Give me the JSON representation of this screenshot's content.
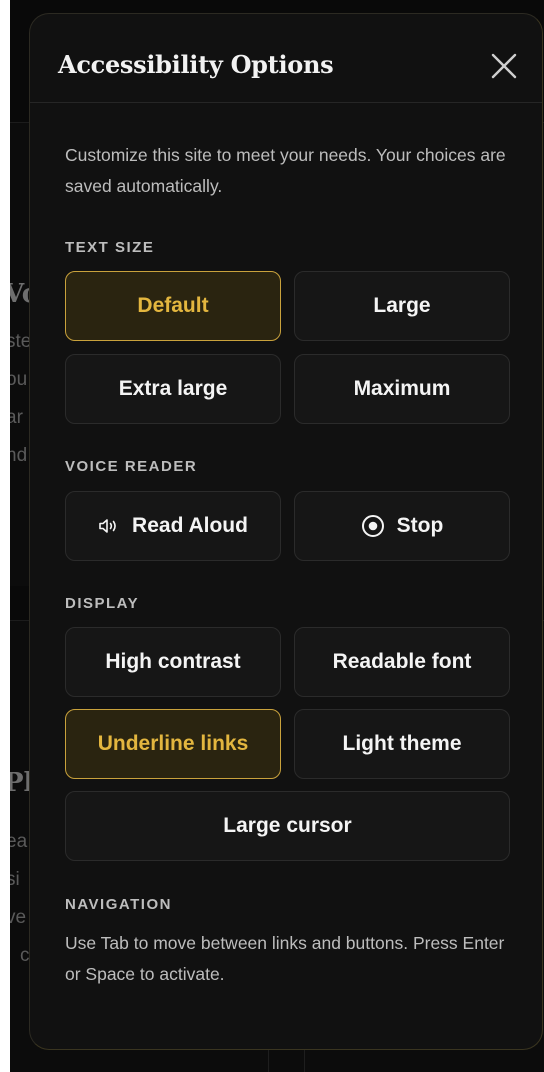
{
  "panel": {
    "title": "Accessibility Options",
    "close_label": "Close",
    "intro": "Customize this site to meet your needs. Your choices are saved automatically."
  },
  "sections": {
    "text_size": {
      "label": "TEXT SIZE",
      "options": [
        {
          "label": "Default",
          "active": true
        },
        {
          "label": "Large",
          "active": false
        },
        {
          "label": "Extra large",
          "active": false
        },
        {
          "label": "Maximum",
          "active": false
        }
      ]
    },
    "voice_reader": {
      "label": "VOICE READER",
      "read_aloud": {
        "label": "Read Aloud",
        "icon": "speaker-icon"
      },
      "stop": {
        "label": "Stop",
        "icon": "stop-circle-icon"
      }
    },
    "display": {
      "label": "DISPLAY",
      "options": [
        {
          "label": "High contrast",
          "active": false
        },
        {
          "label": "Readable font",
          "active": false
        },
        {
          "label": "Underline links",
          "active": true
        },
        {
          "label": "Light theme",
          "active": false
        },
        {
          "label": "Large cursor",
          "active": false
        }
      ]
    },
    "navigation": {
      "label": "NAVIGATION",
      "text": "Use Tab to move between links and buttons. Press Enter or Space to activate."
    }
  },
  "colors": {
    "accent": "#e3b63f",
    "accent_border": "#c9a23c",
    "panel_bg": "#111111",
    "button_bg": "#161616"
  }
}
